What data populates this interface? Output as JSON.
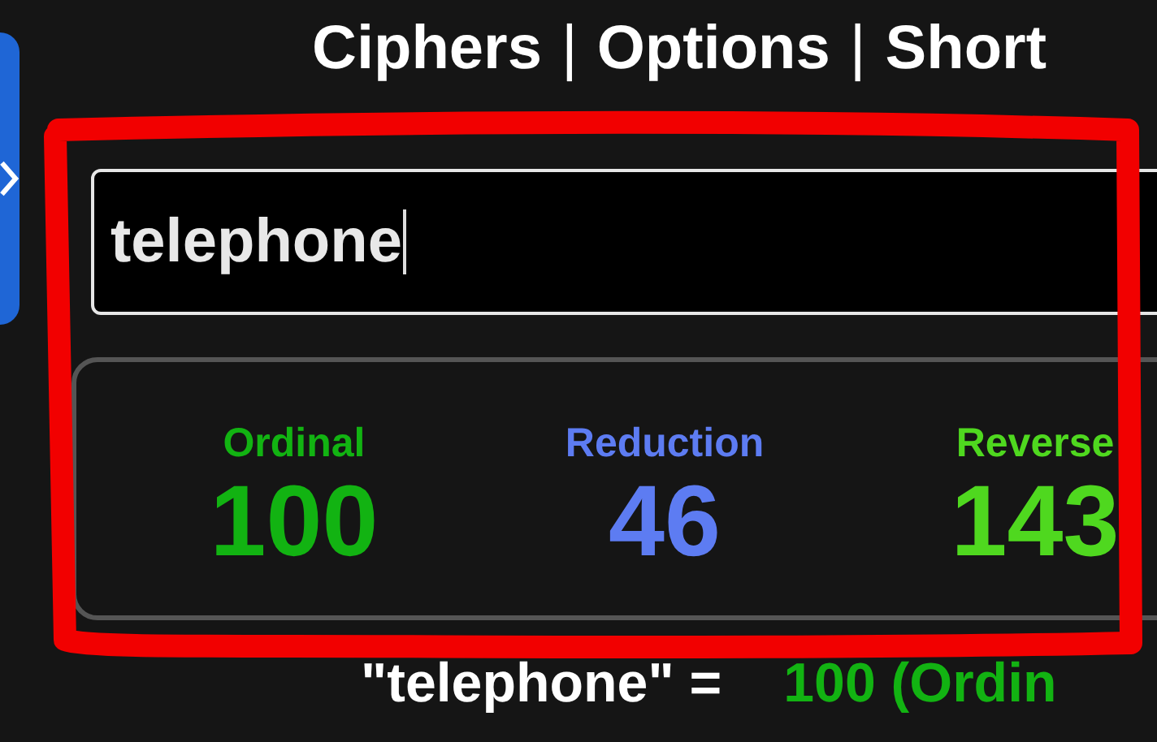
{
  "side_tab": {
    "kind": "chevron"
  },
  "nav": [
    {
      "kind": "link",
      "text": "Ciphers"
    },
    {
      "kind": "separator",
      "text": "|"
    },
    {
      "kind": "link",
      "text": "Options"
    },
    {
      "kind": "separator",
      "text": "|"
    },
    {
      "kind": "link",
      "text": "Short"
    }
  ],
  "search": {
    "value": "telephone"
  },
  "results": [
    {
      "label": "Ordinal",
      "value": "100",
      "color": "#12b312"
    },
    {
      "label": "Reduction",
      "value": "46",
      "color": "#5d7cf2"
    },
    {
      "label": "Reverse",
      "value": "143",
      "color": "#4fd81f"
    }
  ],
  "summary": {
    "phrase": "\"telephone\" =",
    "value": "100 (Ordin",
    "color": "#12b312"
  },
  "annotation": {
    "kind": "outline"
  }
}
